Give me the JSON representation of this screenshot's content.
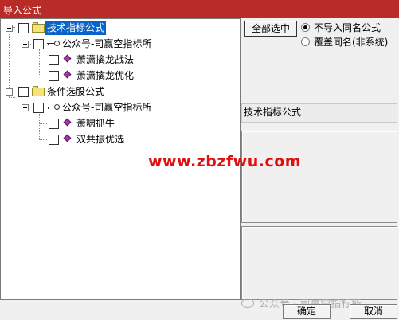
{
  "window": {
    "title": "导入公式"
  },
  "tree": {
    "groups": [
      {
        "label": "技术指标公式",
        "selected": true,
        "children": [
          {
            "label": "公众号-司赢空指标所",
            "items": [
              "萧潇擒龙战法",
              "萧潇擒龙优化"
            ]
          }
        ]
      },
      {
        "label": "条件选股公式",
        "selected": false,
        "children": [
          {
            "label": "公众号-司赢空指标所",
            "items": [
              "萧啸抓牛",
              "双共振优选"
            ]
          }
        ]
      }
    ]
  },
  "actions": {
    "select_all_label": "全部选中",
    "options": [
      {
        "label": "不导入同名公式",
        "checked": true
      },
      {
        "label": "覆盖同名(非系统)",
        "checked": false
      }
    ]
  },
  "detail": {
    "category_label": "技术指标公式"
  },
  "watermarks": {
    "site": "www.zbzfwu.com",
    "wechat": "公众号 · 司赢空指标所"
  },
  "footer": {
    "ok_label": "确定",
    "cancel_label": "取消"
  }
}
